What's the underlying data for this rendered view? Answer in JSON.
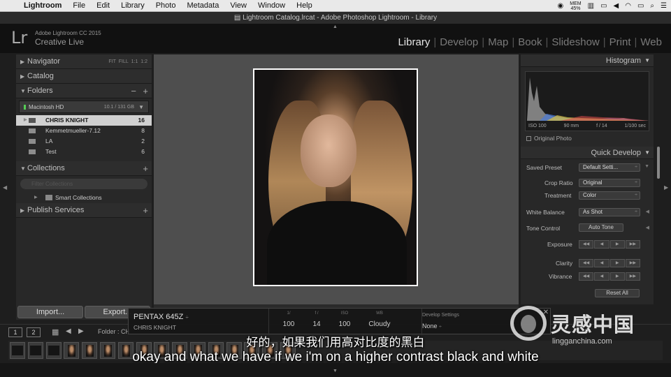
{
  "menubar": {
    "app": "Lightroom",
    "items": [
      "File",
      "Edit",
      "Library",
      "Photo",
      "Metadata",
      "View",
      "Window",
      "Help"
    ],
    "mem": "MEM",
    "mem_pct": "45%"
  },
  "window_title": "Lightroom Catalog.lrcat - Adobe Photoshop Lightroom - Library",
  "header": {
    "logo": "Lr",
    "brand_line1": "Adobe Lightroom CC 2015",
    "brand_line2": "Creative Live",
    "modules": [
      "Library",
      "Develop",
      "Map",
      "Book",
      "Slideshow",
      "Print",
      "Web"
    ],
    "active_module": "Library"
  },
  "left_panel": {
    "navigator": {
      "label": "Navigator",
      "zoom_fit": "FIT",
      "zoom_fill": "FILL",
      "zoom_1": "1:1",
      "zoom_2": "1:2"
    },
    "catalog": {
      "label": "Catalog"
    },
    "folders": {
      "label": "Folders",
      "volume": {
        "name": "Macintosh HD",
        "capacity": "10.1 / 131 GB"
      },
      "items": [
        {
          "name": "CHRIS KNIGHT",
          "count": "16"
        },
        {
          "name": "Kemmetmueller-7.12",
          "count": "8"
        },
        {
          "name": "LA",
          "count": "2"
        },
        {
          "name": "Test",
          "count": "6"
        }
      ]
    },
    "collections": {
      "label": "Collections",
      "filter_placeholder": "Filter Collections",
      "smart": "Smart Collections"
    },
    "publish": {
      "label": "Publish Services"
    },
    "import_label": "Import...",
    "export_label": "Export..."
  },
  "right_panel": {
    "histogram": {
      "label": "Histogram",
      "iso": "ISO 100",
      "focal": "90 mm",
      "aperture": "f / 14",
      "shutter": "1/100 sec",
      "original_photo": "Original Photo"
    },
    "quick_develop": {
      "label": "Quick Develop",
      "saved_preset_label": "Saved Preset",
      "saved_preset_value": "Default Setti...",
      "crop_label": "Crop Ratio",
      "crop_value": "Original",
      "treatment_label": "Treatment",
      "treatment_value": "Color",
      "wb_label": "White Balance",
      "wb_value": "As Shot",
      "tone_label": "Tone Control",
      "auto_tone": "Auto Tone",
      "exposure": "Exposure",
      "clarity": "Clarity",
      "vibrance": "Vibrance",
      "reset_all": "Reset All"
    }
  },
  "filmstrip_bar": {
    "screen1": "1",
    "screen2": "2",
    "folder_text": "Folder : CH"
  },
  "hud": {
    "camera": "PENTAX 645Z",
    "folder": "CHRIS KNIGHT",
    "cols": [
      {
        "h": "1/",
        "v": "100"
      },
      {
        "h": "f /",
        "v": "14"
      },
      {
        "h": "ISO",
        "v": "100"
      },
      {
        "h": "WB",
        "v": "Cloudy"
      }
    ],
    "develop_label": "Develop Settings",
    "develop_value": "None"
  },
  "subtitles": {
    "cn": "好的，如果我们用高对比度的黑白",
    "en": "okay and what we have if we i'm on a higher contrast black and white"
  },
  "watermark": {
    "cn": "灵感中国",
    "url": "lingganchina.com"
  },
  "colors": {
    "accent_bg": "#1e1e1e",
    "panel": "#282828",
    "center": "#4e4e4e",
    "selected_folder": "#d0d0d0"
  },
  "filmstrip_count": 16
}
